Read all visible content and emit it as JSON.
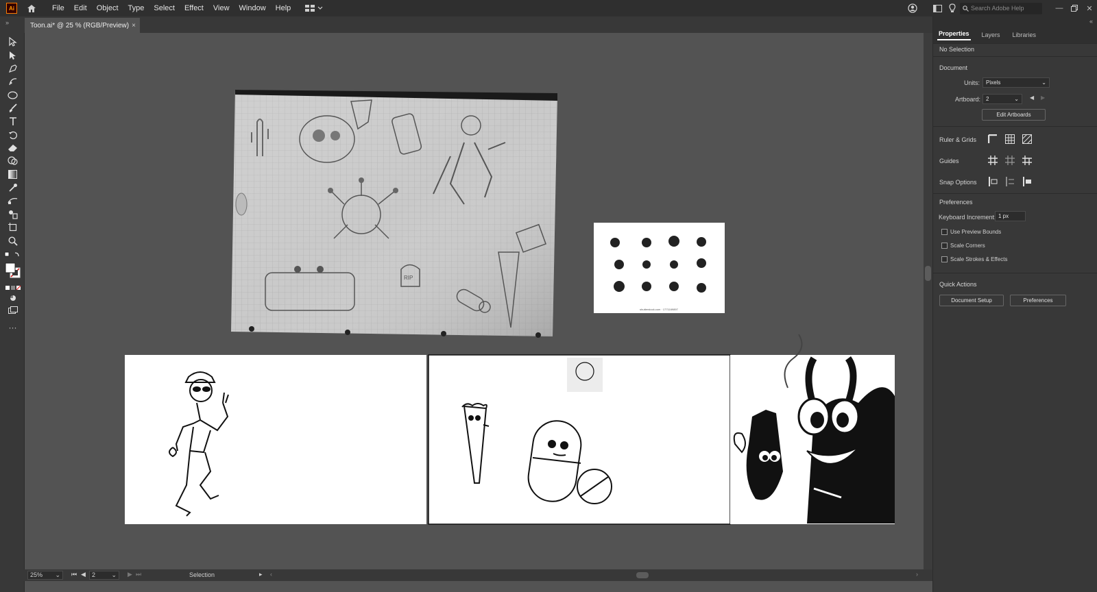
{
  "app": {
    "logo_text": "Ai"
  },
  "menu": {
    "items": [
      "File",
      "Edit",
      "Object",
      "Type",
      "Select",
      "Effect",
      "View",
      "Window",
      "Help"
    ]
  },
  "search": {
    "placeholder": "Search Adobe Help"
  },
  "document_tab": {
    "title": "Toon.ai* @ 25 % (RGB/Preview)",
    "close": "×"
  },
  "panel": {
    "tabs": [
      "Properties",
      "Layers",
      "Libraries"
    ],
    "selection_status": "No Selection",
    "document_section": "Document",
    "units_label": "Units:",
    "units_value": "Pixels",
    "artboard_label": "Artboard:",
    "artboard_value": "2",
    "edit_artboards": "Edit Artboards",
    "ruler_grids": "Ruler & Grids",
    "guides": "Guides",
    "snap_options": "Snap Options",
    "preferences_section": "Preferences",
    "keyboard_increment_label": "Keyboard Increment:",
    "keyboard_increment_value": "1 px",
    "use_preview_bounds": "Use Preview Bounds",
    "scale_corners": "Scale Corners",
    "scale_strokes": "Scale Strokes & Effects",
    "quick_actions": "Quick Actions",
    "document_setup": "Document Setup",
    "preferences_button": "Preferences"
  },
  "status": {
    "zoom": "25%",
    "artboard": "2",
    "tool": "Selection"
  },
  "canvas": {
    "sheet_caption": "shutterstock.com · 1771169897",
    "rip_text": "RIP"
  },
  "colors": {
    "menubar": "#2f2f2f",
    "panel": "#383838",
    "canvas": "#535353",
    "accent_logo": "#ff9a00"
  }
}
